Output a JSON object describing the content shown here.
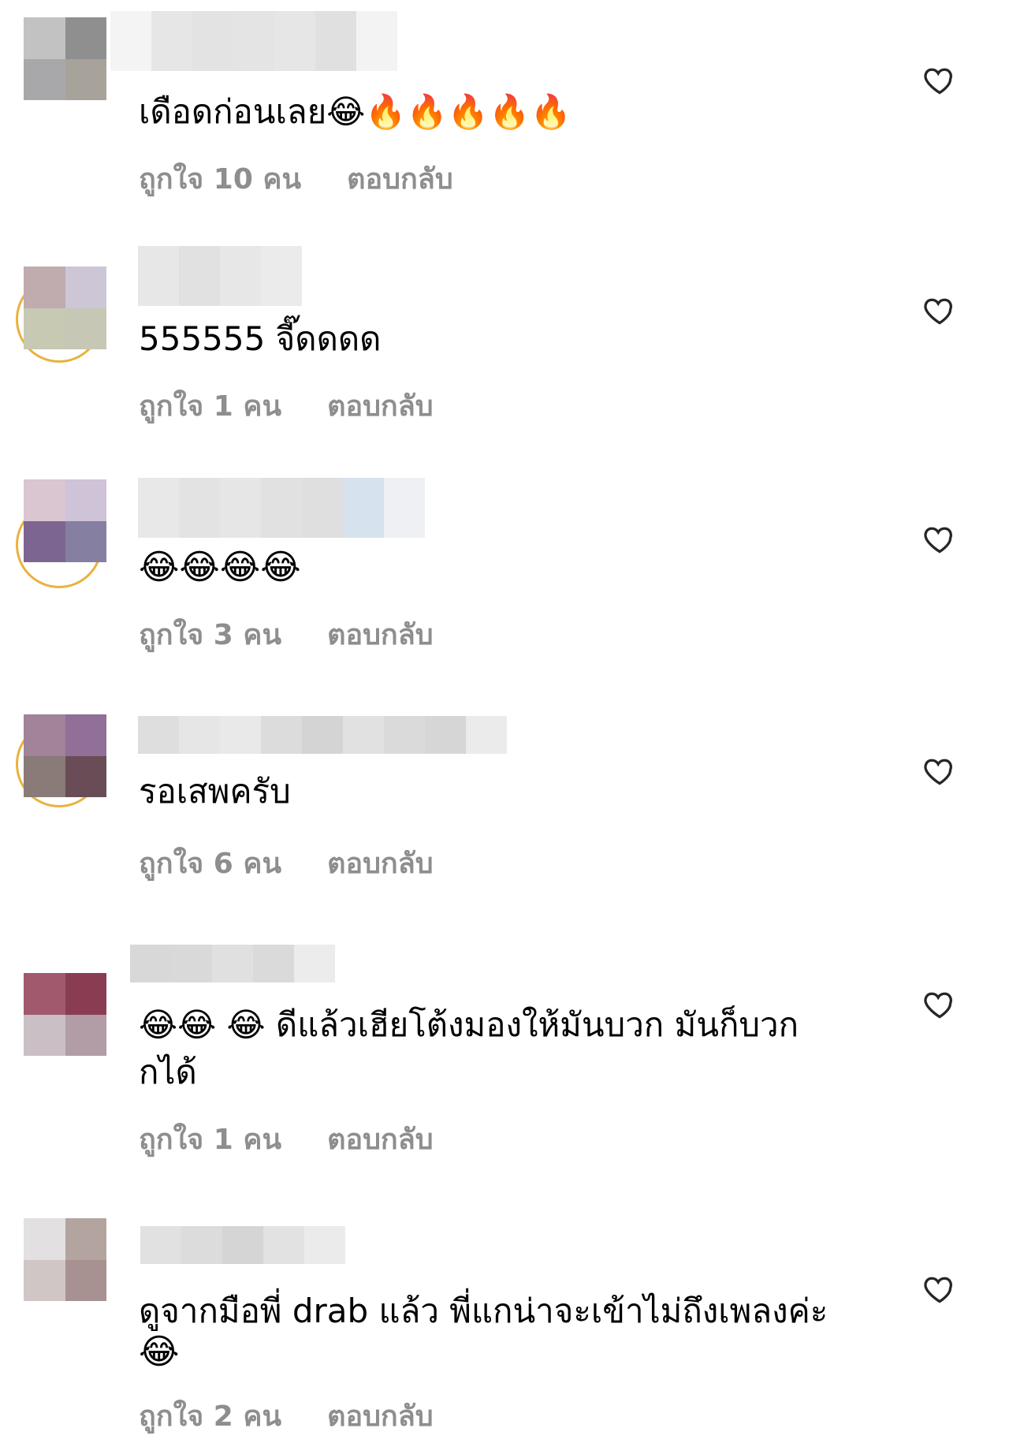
{
  "comments": [
    {
      "text": "เดือดก่อนเลย😂🔥🔥🔥🔥🔥",
      "likes": "ถูกใจ 10 คน",
      "reply": "ตอบกลับ"
    },
    {
      "text": "555555 จี๊ดดดด",
      "likes": "ถูกใจ 1 คน",
      "reply": "ตอบกลับ"
    },
    {
      "text": "😂😂😂😂",
      "likes": "ถูกใจ 3 คน",
      "reply": "ตอบกลับ"
    },
    {
      "text": "รอเสพครับ",
      "likes": "ถูกใจ 6 คน",
      "reply": "ตอบกลับ"
    },
    {
      "text": "😂😂 😂 ดีแล้วเฮียโต้งมองให้มันบวก มันก็บวก",
      "text2": "กได้",
      "likes": "ถูกใจ 1 คน",
      "reply": "ตอบกลับ"
    },
    {
      "text": "ดูจากมือพี่ drab แล้ว พี่แกน่าจะเข้าไม่ถึงเพลงค่ะ",
      "text2": "😂",
      "likes": "ถูกใจ 2 คน",
      "reply": "ตอบกลับ"
    }
  ],
  "icons": {
    "like": "heart-outline-icon"
  },
  "colors": {
    "meta": "#8e8e8e",
    "ring": "#e9b23d"
  }
}
